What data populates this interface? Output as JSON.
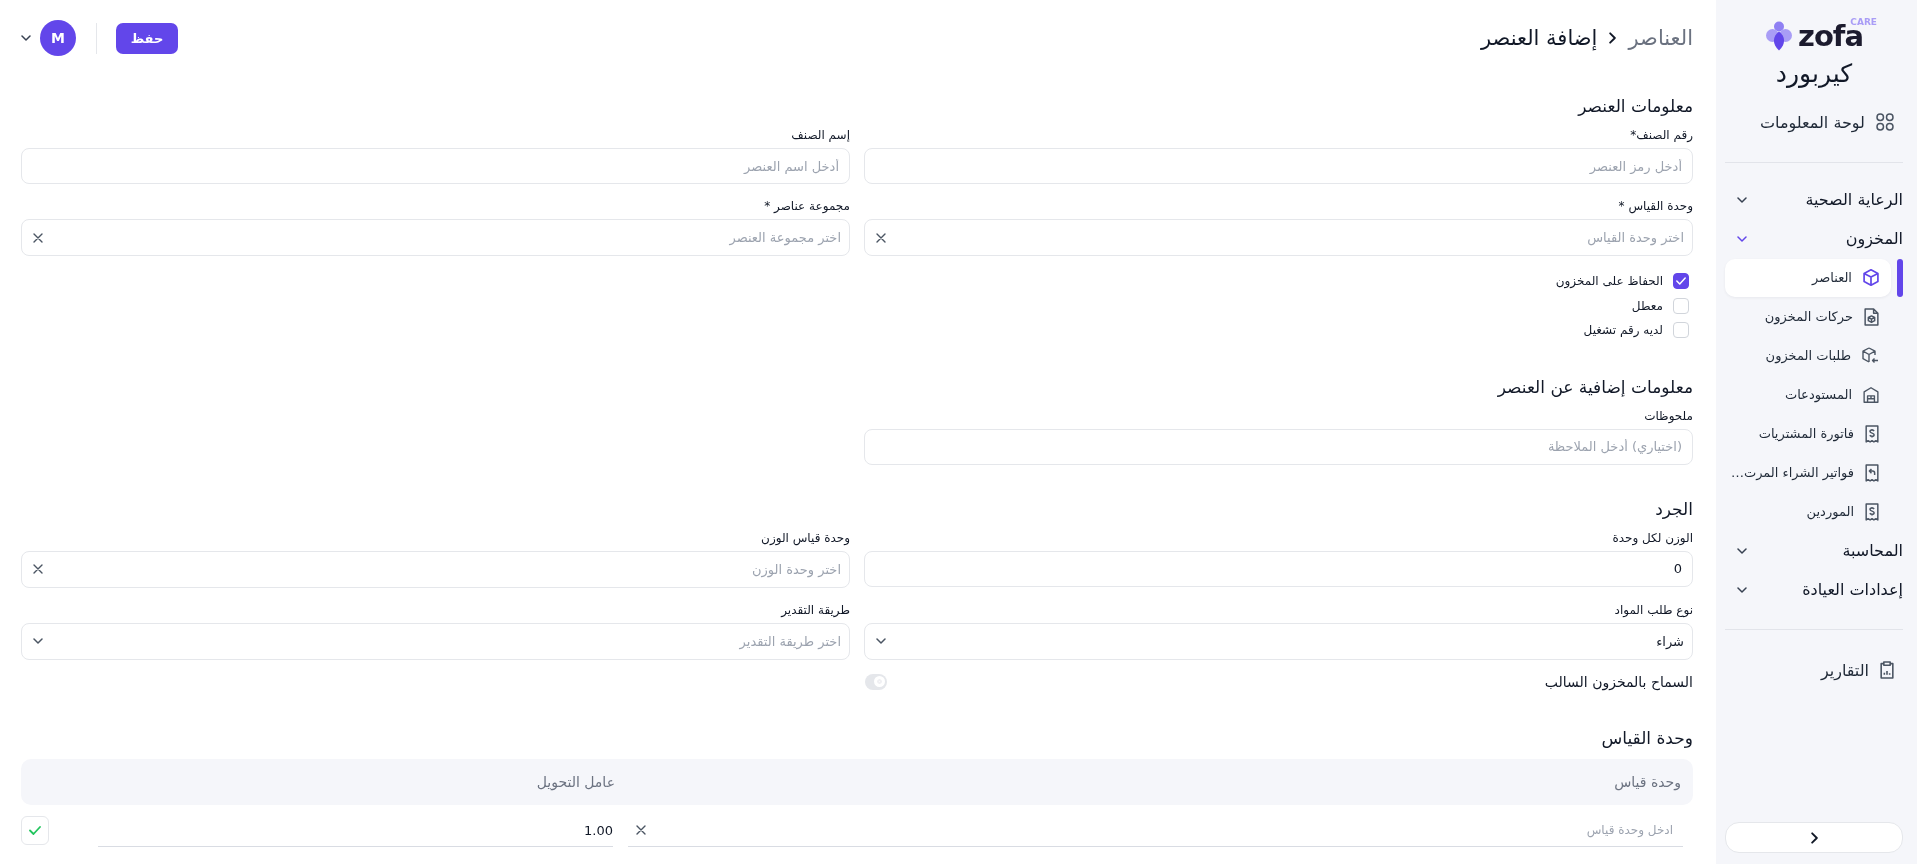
{
  "sidebar": {
    "logo": {
      "wordmark": "zofa",
      "tag": "CARE"
    },
    "app_name": "كيربورد",
    "dashboard": {
      "label": "لوحة المعلومات"
    },
    "groups": [
      {
        "label": "الرعاية الصحية",
        "expanded": false
      },
      {
        "label": "المخزون",
        "expanded": true,
        "children": [
          {
            "label": "العناصر",
            "selected": true
          },
          {
            "label": "حركات المخزون",
            "selected": false
          },
          {
            "label": "طلبات المخزون",
            "selected": false
          },
          {
            "label": "المستودعات",
            "selected": false
          },
          {
            "label": "فاتورة المشتريات",
            "selected": false
          },
          {
            "label": "فواتير الشراء المرت…",
            "selected": false
          },
          {
            "label": "الموردين",
            "selected": false
          }
        ]
      },
      {
        "label": "المحاسبة",
        "expanded": false
      },
      {
        "label": "إعدادات العيادة",
        "expanded": false
      }
    ],
    "reports": {
      "label": "التقارير"
    }
  },
  "header": {
    "breadcrumb": [
      {
        "label": "العناصر",
        "current": false
      },
      {
        "label": "إضافة العنصر",
        "current": true
      }
    ],
    "save_button": "حفظ",
    "user": {
      "initial": "M"
    }
  },
  "sections": [
    {
      "title": "معلومات العنصر",
      "fields": [
        {
          "kind": "text",
          "label": "رقم الصنف*",
          "placeholder": "أدخل رمز العنصر"
        },
        {
          "kind": "text",
          "label": "إسم الصنف",
          "placeholder": "أدخل اسم العنصر"
        },
        {
          "kind": "clearable",
          "label": "وحدة القياس *",
          "placeholder": "اختر وحدة القياس"
        },
        {
          "kind": "clearable",
          "label": "مجموعة عناصر *",
          "placeholder": "اختر مجموعة العنصر"
        }
      ],
      "checkboxes": [
        {
          "label": "الحفاظ على المخزون",
          "checked": true
        },
        {
          "label": "معطل",
          "checked": false
        },
        {
          "label": "لديه رقم تشغيل",
          "checked": false
        }
      ]
    },
    {
      "title": "معلومات إضافية عن العنصر",
      "fields": [
        {
          "kind": "text",
          "label": "ملحوظات",
          "placeholder": "(اختياري) أدخل الملاحظة"
        }
      ]
    },
    {
      "title": "الجرد",
      "fields": [
        {
          "kind": "text",
          "label": "الوزن لكل وحدة",
          "value": "0"
        },
        {
          "kind": "clearable",
          "label": "وحدة قياس الوزن",
          "placeholder": "اختر وحدة الوزن"
        },
        {
          "kind": "dropdown",
          "label": "نوع طلب المواد",
          "value": "شراء"
        },
        {
          "kind": "dropdown",
          "label": "طريقة التقدير",
          "placeholder": "اختر طريقة التقدير"
        }
      ],
      "toggles": [
        {
          "label": "السماح بالمخزون السالب",
          "on": false
        }
      ]
    },
    {
      "title": "وحدة القياس",
      "table": {
        "columns": [
          "وحدة قياس",
          "عامل التحويل"
        ],
        "rows": [
          {
            "unit": {
              "placeholder": "ادخل وحدة قياس"
            },
            "factor": {
              "value": "1.00"
            }
          }
        ]
      }
    }
  ]
}
